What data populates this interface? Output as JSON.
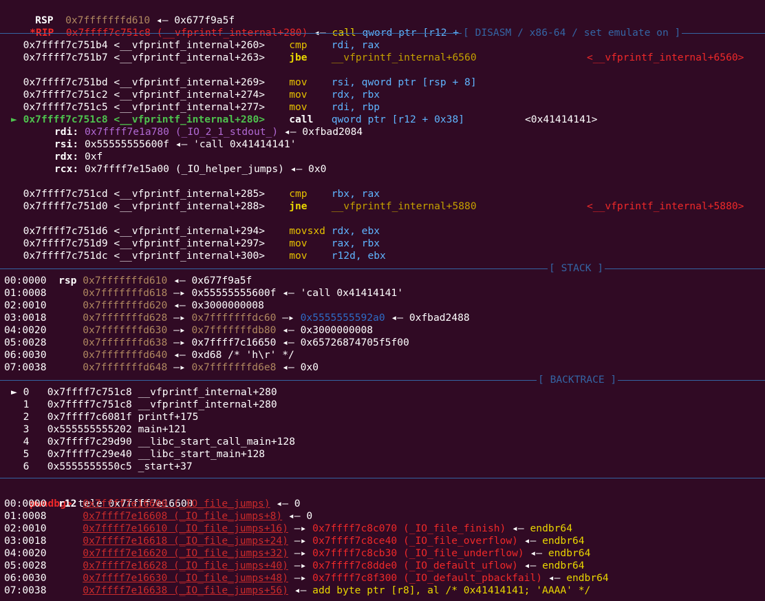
{
  "registers_top": {
    "rsp": {
      "name": "RSP",
      "addr": "0x7fffffffd610",
      "arrow": "◂—",
      "value": "0x677f9a5f"
    },
    "rip": {
      "name": "*RIP",
      "addr": "0x7ffff7c751c8",
      "sym": "(__vfprintf_internal+280)",
      "arrow": "◂—",
      "instr": "call",
      "operand": "qword ptr [r12 + 0x38]"
    }
  },
  "sections": {
    "disasm": "[ DISASM / x86-64 / set emulate on ]",
    "stack": "[ STACK ]",
    "backtrace": "[ BACKTRACE ]"
  },
  "disasm": [
    {
      "addr": "0x7ffff7c751b4",
      "sym": "<__vfprintf_internal+260>",
      "mnem": "cmp",
      "ops": "rdi, rax",
      "target": ""
    },
    {
      "addr": "0x7ffff7c751b7",
      "sym": "<__vfprintf_internal+263>",
      "mnem": "jbe",
      "ops": "__vfprintf_internal+6560",
      "target": "<__vfprintf_internal+6560>"
    },
    {
      "addr": "0x7ffff7c751bd",
      "sym": "<__vfprintf_internal+269>",
      "mnem": "mov",
      "ops": "rsi, qword ptr [rsp + 8]",
      "target": ""
    },
    {
      "addr": "0x7ffff7c751c2",
      "sym": "<__vfprintf_internal+274>",
      "mnem": "mov",
      "ops": "rdx, rbx",
      "target": ""
    },
    {
      "addr": "0x7ffff7c751c5",
      "sym": "<__vfprintf_internal+277>",
      "mnem": "mov",
      "ops": "rdi, rbp",
      "target": ""
    },
    {
      "addr": "0x7ffff7c751c8",
      "sym": "<__vfprintf_internal+280>",
      "mnem": "call",
      "ops": "qword ptr [r12 + 0x38]",
      "target": "<0x41414141>",
      "marker": "►"
    },
    {
      "addr": "0x7ffff7c751cd",
      "sym": "<__vfprintf_internal+285>",
      "mnem": "cmp",
      "ops": "rbx, rax",
      "target": ""
    },
    {
      "addr": "0x7ffff7c751d0",
      "sym": "<__vfprintf_internal+288>",
      "mnem": "jne",
      "ops": "__vfprintf_internal+5880",
      "target": "<__vfprintf_internal+5880>"
    },
    {
      "addr": "0x7ffff7c751d6",
      "sym": "<__vfprintf_internal+294>",
      "mnem": "movsxd",
      "ops": "rdx, ebx",
      "target": ""
    },
    {
      "addr": "0x7ffff7c751d9",
      "sym": "<__vfprintf_internal+297>",
      "mnem": "mov",
      "ops": "rax, rbx",
      "target": ""
    },
    {
      "addr": "0x7ffff7c751dc",
      "sym": "<__vfprintf_internal+300>",
      "mnem": "mov",
      "ops": "r12d, ebx",
      "target": ""
    }
  ],
  "call_args": [
    {
      "reg": "rdi:",
      "val": "0x7ffff7e1a780 (_IO_2_1_stdout_)",
      "rest": "◂— 0xfbad2084"
    },
    {
      "reg": "rsi:",
      "val": "0x55555555600f",
      "rest": "◂— 'call 0x41414141'"
    },
    {
      "reg": "rdx:",
      "val": "0xf",
      "rest": ""
    },
    {
      "reg": "rcx:",
      "val": "0x7ffff7e15a00 (_IO_helper_jumps)",
      "rest": "◂— 0x0"
    }
  ],
  "stack": [
    {
      "idx": "00:0000",
      "reg": "rsp",
      "addr": "0x7fffffffd610",
      "a1": "◂—",
      "v1": "0x677f9a5f",
      "a2": "",
      "v2": "",
      "a3": "",
      "v3": ""
    },
    {
      "idx": "01:0008",
      "reg": "",
      "addr": "0x7fffffffd618",
      "a1": "—▸",
      "v1": "0x55555555600f",
      "a2": "◂—",
      "v2": "'call 0x41414141'",
      "a3": "",
      "v3": ""
    },
    {
      "idx": "02:0010",
      "reg": "",
      "addr": "0x7fffffffd620",
      "a1": "◂—",
      "v1": "0x3000000008",
      "a2": "",
      "v2": "",
      "a3": "",
      "v3": ""
    },
    {
      "idx": "03:0018",
      "reg": "",
      "addr": "0x7fffffffd628",
      "a1": "—▸",
      "v1": "0x7fffffffdc60",
      "a2": "—▸",
      "v2": "0x5555555592a0",
      "a3": "◂—",
      "v3": "0xfbad2488"
    },
    {
      "idx": "04:0020",
      "reg": "",
      "addr": "0x7fffffffd630",
      "a1": "—▸",
      "v1": "0x7fffffffdb80",
      "a2": "◂—",
      "v2": "0x3000000008",
      "a3": "",
      "v3": ""
    },
    {
      "idx": "05:0028",
      "reg": "",
      "addr": "0x7fffffffd638",
      "a1": "—▸",
      "v1": "0x7ffff7c16650",
      "a2": "◂—",
      "v2": "0x65726874705f5f00",
      "a3": "",
      "v3": ""
    },
    {
      "idx": "06:0030",
      "reg": "",
      "addr": "0x7fffffffd640",
      "a1": "◂—",
      "v1": "0xd68 /* 'h\\r' */",
      "a2": "",
      "v2": "",
      "a3": "",
      "v3": ""
    },
    {
      "idx": "07:0038",
      "reg": "",
      "addr": "0x7fffffffd648",
      "a1": "—▸",
      "v1": "0x7fffffffd6e8",
      "a2": "◂—",
      "v2": "0x0",
      "a3": "",
      "v3": ""
    }
  ],
  "backtrace": [
    {
      "marker": "►",
      "n": "0",
      "addr": "0x7ffff7c751c8",
      "sym": "__vfprintf_internal+280"
    },
    {
      "marker": "",
      "n": "1",
      "addr": "0x7ffff7c751c8",
      "sym": "__vfprintf_internal+280"
    },
    {
      "marker": "",
      "n": "2",
      "addr": "0x7ffff7c6081f",
      "sym": "printf+175"
    },
    {
      "marker": "",
      "n": "3",
      "addr": "0x555555555202",
      "sym": "main+121"
    },
    {
      "marker": "",
      "n": "4",
      "addr": "0x7ffff7c29d90",
      "sym": "__libc_start_call_main+128"
    },
    {
      "marker": "",
      "n": "5",
      "addr": "0x7ffff7c29e40",
      "sym": "__libc_start_main+128"
    },
    {
      "marker": "",
      "n": "6",
      "addr": "0x5555555550c5",
      "sym": "_start+37"
    }
  ],
  "prompt": {
    "label": "pwndbg>",
    "command": "tele 0x7ffff7e16600"
  },
  "tele": [
    {
      "idx": "00:0000",
      "reg": "r12",
      "addr": "0x7ffff7e16600 (_IO_file_jumps)",
      "a1": "◂—",
      "v1": "0",
      "a2": "",
      "v2": ""
    },
    {
      "idx": "01:0008",
      "reg": "",
      "addr": "0x7ffff7e16608 (_IO_file_jumps+8)",
      "a1": "◂—",
      "v1": "0",
      "a2": "",
      "v2": ""
    },
    {
      "idx": "02:0010",
      "reg": "",
      "addr": "0x7ffff7e16610 (_IO_file_jumps+16)",
      "a1": "—▸",
      "v1": "0x7ffff7c8c070 (_IO_file_finish)",
      "a2": "◂—",
      "v2": "endbr64"
    },
    {
      "idx": "03:0018",
      "reg": "",
      "addr": "0x7ffff7e16618 (_IO_file_jumps+24)",
      "a1": "—▸",
      "v1": "0x7ffff7c8ce40 (_IO_file_overflow)",
      "a2": "◂—",
      "v2": "endbr64"
    },
    {
      "idx": "04:0020",
      "reg": "",
      "addr": "0x7ffff7e16620 (_IO_file_jumps+32)",
      "a1": "—▸",
      "v1": "0x7ffff7c8cb30 (_IO_file_underflow)",
      "a2": "◂—",
      "v2": "endbr64"
    },
    {
      "idx": "05:0028",
      "reg": "",
      "addr": "0x7ffff7e16628 (_IO_file_jumps+40)",
      "a1": "—▸",
      "v1": "0x7ffff7c8dde0 (_IO_default_uflow)",
      "a2": "◂—",
      "v2": "endbr64"
    },
    {
      "idx": "06:0030",
      "reg": "",
      "addr": "0x7ffff7e16630 (_IO_file_jumps+48)",
      "a1": "—▸",
      "v1": "0x7ffff7c8f300 (_IO_default_pbackfail)",
      "a2": "◂—",
      "v2": "endbr64"
    },
    {
      "idx": "07:0038",
      "reg": "",
      "addr": "0x7ffff7e16638 (_IO_file_jumps+56)",
      "a1": "◂—",
      "v1": "add byte ptr [r8], al /* 0x41414141; 'AAAA' */",
      "a2": "",
      "v2": ""
    }
  ],
  "colors": {
    "background": "#300a24",
    "separator": "#3465a4",
    "red": "#ef2929",
    "yellow": "#c4a000",
    "green": "#4ec24e"
  }
}
